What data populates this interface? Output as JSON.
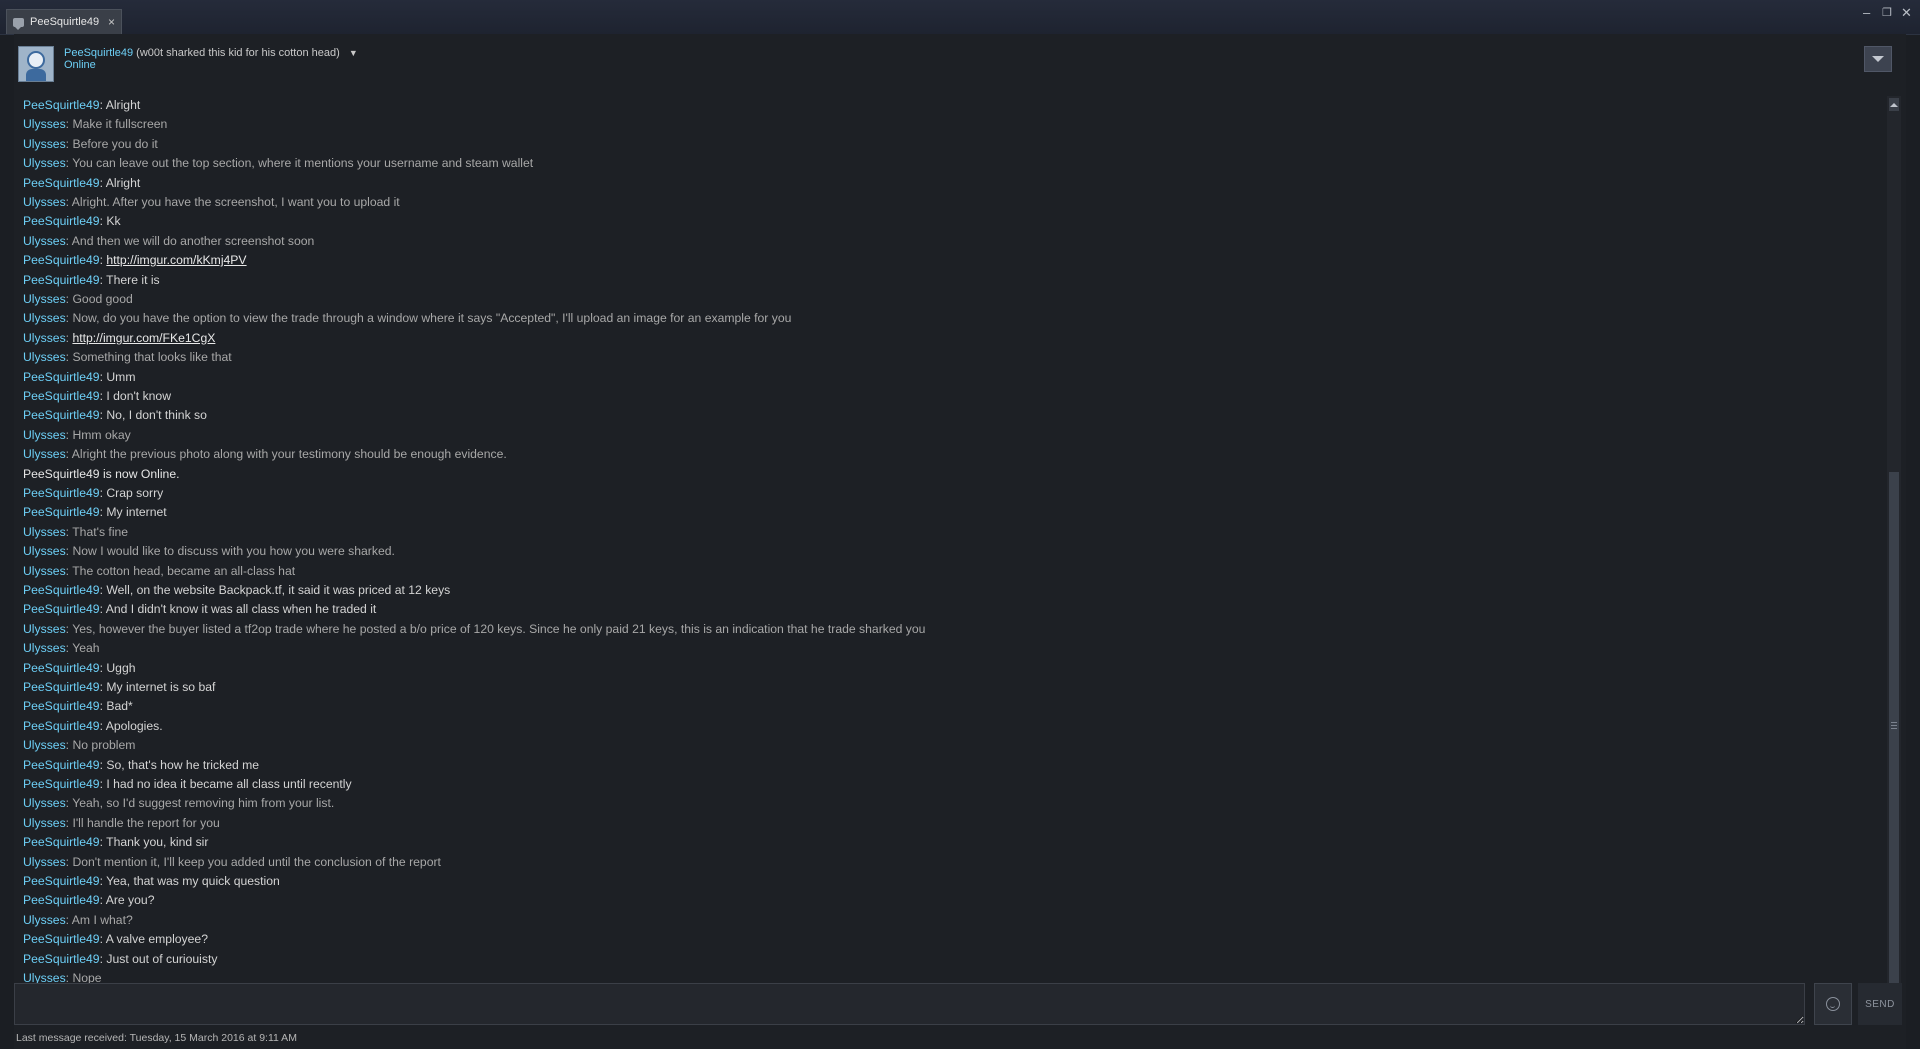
{
  "window": {
    "tab_label": "PeeSquirtle49",
    "tab_close": "×",
    "minimize": "–",
    "restore": "❐",
    "close": "✕"
  },
  "header": {
    "name": "PeeSquirtle49",
    "nickname": "(w00t sharked this kid for his cotton head)",
    "dropdown": "▼",
    "status": "Online"
  },
  "messages": [
    {
      "who": "PeeSquirtle49",
      "kind": "pee",
      "text": "Alright"
    },
    {
      "who": "Ulysses",
      "kind": "uly",
      "text": "Make it fullscreen"
    },
    {
      "who": "Ulysses",
      "kind": "uly",
      "text": "Before you do it"
    },
    {
      "who": "Ulysses",
      "kind": "uly",
      "text": "You can leave out the top section, where it mentions your username and steam wallet"
    },
    {
      "who": "PeeSquirtle49",
      "kind": "pee",
      "text": "Alright"
    },
    {
      "who": "Ulysses",
      "kind": "uly",
      "text": "Alright. After you have the screenshot, I want you to upload it"
    },
    {
      "who": "PeeSquirtle49",
      "kind": "pee",
      "text": "Kk"
    },
    {
      "who": "Ulysses",
      "kind": "uly",
      "text": "And then we will do another screenshot soon"
    },
    {
      "who": "PeeSquirtle49",
      "kind": "pee",
      "text": "http://imgur.com/kKmj4PV",
      "link": true
    },
    {
      "who": "PeeSquirtle49",
      "kind": "pee",
      "text": "There it is"
    },
    {
      "who": "Ulysses",
      "kind": "uly",
      "text": "Good good"
    },
    {
      "who": "Ulysses",
      "kind": "uly",
      "text": "Now, do you have the option to view the trade through a window where it says \"Accepted\", I'll upload an image for an example for you"
    },
    {
      "who": "Ulysses",
      "kind": "uly",
      "text": "http://imgur.com/FKe1CgX",
      "link": true
    },
    {
      "who": "Ulysses",
      "kind": "uly",
      "text": "Something that looks like that"
    },
    {
      "who": "PeeSquirtle49",
      "kind": "pee",
      "text": "Umm"
    },
    {
      "who": "PeeSquirtle49",
      "kind": "pee",
      "text": "I don't know"
    },
    {
      "who": "PeeSquirtle49",
      "kind": "pee",
      "text": "No, I don't think so"
    },
    {
      "who": "Ulysses",
      "kind": "uly",
      "text": "Hmm okay"
    },
    {
      "who": "Ulysses",
      "kind": "uly",
      "text": "Alright the previous photo along with your testimony should be enough evidence."
    },
    {
      "who": "",
      "kind": "sys",
      "text": "PeeSquirtle49 is now Online."
    },
    {
      "who": "PeeSquirtle49",
      "kind": "pee",
      "text": "Crap sorry"
    },
    {
      "who": "PeeSquirtle49",
      "kind": "pee",
      "text": "My internet"
    },
    {
      "who": "Ulysses",
      "kind": "uly",
      "text": "That's fine"
    },
    {
      "who": "Ulysses",
      "kind": "uly",
      "text": "Now I would like to discuss with you how you were sharked."
    },
    {
      "who": "Ulysses",
      "kind": "uly",
      "text": "The cotton head, became an all-class hat"
    },
    {
      "who": "PeeSquirtle49",
      "kind": "pee",
      "text": "Well, on the website Backpack.tf, it said it was priced at 12 keys"
    },
    {
      "who": "PeeSquirtle49",
      "kind": "pee",
      "text": "And I didn't know it was all class when he traded it"
    },
    {
      "who": "Ulysses",
      "kind": "uly",
      "text": "Yes, however the buyer listed a tf2op trade where he posted a b/o price of 120 keys. Since he only paid 21 keys, this is an indication that he trade sharked you"
    },
    {
      "who": "Ulysses",
      "kind": "uly",
      "text": "Yeah"
    },
    {
      "who": "PeeSquirtle49",
      "kind": "pee",
      "text": "Uggh"
    },
    {
      "who": "PeeSquirtle49",
      "kind": "pee",
      "text": "My internet is so baf"
    },
    {
      "who": "PeeSquirtle49",
      "kind": "pee",
      "text": "Bad*"
    },
    {
      "who": "PeeSquirtle49",
      "kind": "pee",
      "text": "Apologies."
    },
    {
      "who": "Ulysses",
      "kind": "uly",
      "text": "No problem"
    },
    {
      "who": "PeeSquirtle49",
      "kind": "pee",
      "text": "So, that's how he tricked me"
    },
    {
      "who": "PeeSquirtle49",
      "kind": "pee",
      "text": "I had no idea it became all class until recently"
    },
    {
      "who": "Ulysses",
      "kind": "uly",
      "text": "Yeah, so I'd suggest removing him from your list."
    },
    {
      "who": "Ulysses",
      "kind": "uly",
      "text": "I'll handle the report for you"
    },
    {
      "who": "PeeSquirtle49",
      "kind": "pee",
      "text": "Thank you, kind sir"
    },
    {
      "who": "Ulysses",
      "kind": "uly",
      "text": "Don't mention it, I'll keep you added until the conclusion of the report"
    },
    {
      "who": "PeeSquirtle49",
      "kind": "pee",
      "text": "Yea, that was my quick question"
    },
    {
      "who": "PeeSquirtle49",
      "kind": "pee",
      "text": "Are you?"
    },
    {
      "who": "Ulysses",
      "kind": "uly",
      "text": "Am I what?"
    },
    {
      "who": "PeeSquirtle49",
      "kind": "pee",
      "text": "A valve employee?"
    },
    {
      "who": "PeeSquirtle49",
      "kind": "pee",
      "text": "Just out of curiouisty"
    },
    {
      "who": "Ulysses",
      "kind": "uly",
      "text": "Nope"
    }
  ],
  "compose": {
    "placeholder": "",
    "send_label": "SEND"
  },
  "footer": {
    "last_received": "Last message received: Tuesday, 15 March 2016 at 9:11 AM"
  }
}
